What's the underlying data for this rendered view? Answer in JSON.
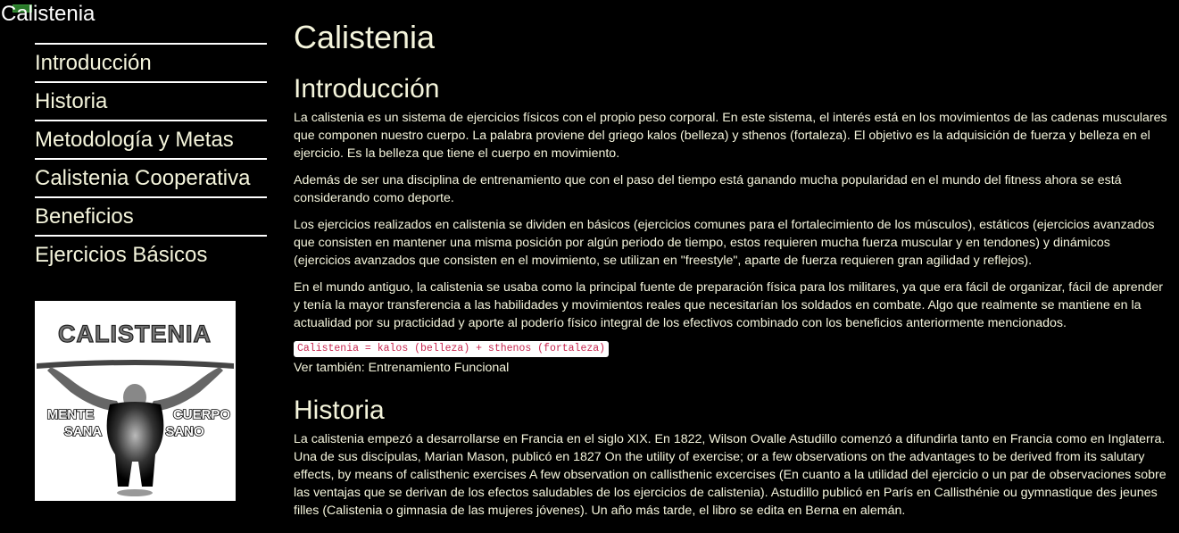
{
  "site": {
    "title": "Calistenia"
  },
  "nav": {
    "items": [
      {
        "label": "Introducción"
      },
      {
        "label": "Historia"
      },
      {
        "label": "Metodología y Metas"
      },
      {
        "label": "Calistenia Cooperativa"
      },
      {
        "label": "Beneficios"
      },
      {
        "label": "Ejercicios Básicos"
      }
    ]
  },
  "logo": {
    "top_text": "CALISTENIA",
    "left_text_1": "MENTE",
    "left_text_2": "SANA",
    "right_text_1": "CUERPO",
    "right_text_2": "SANO"
  },
  "main": {
    "title": "Calistenia",
    "intro": {
      "heading": "Introducción",
      "p1": "La calistenia es un sistema de ejercicios físicos con el propio peso corporal. En este sistema, el interés está en los movimientos de las cadenas musculares que componen nuestro cuerpo. La palabra proviene del griego kalos (belleza) y sthenos (fortaleza). El objetivo es la adquisición de fuerza y belleza en el ejercicio. Es la belleza que tiene el cuerpo en movimiento.",
      "p2": "Además de ser una disciplina de entrenamiento que con el paso del tiempo está ganando mucha popularidad en el mundo del fitness ahora se está considerando como deporte.",
      "p3": "Los ejercicios realizados en calistenia se dividen en básicos (ejercicios comunes para el fortalecimiento de los músculos), estáticos (ejercicios avanzados que consisten en mantener una misma posición por algún periodo de tiempo, estos requieren mucha fuerza muscular y en tendones) y dinámicos (ejercicios avanzados que consisten en el movimiento, se utilizan en \"freestyle\", aparte de fuerza requieren gran agilidad y reflejos).",
      "p4": "En el mundo antiguo, la calistenia se usaba como la principal fuente de preparación física para los militares, ya que era fácil de organizar, fácil de aprender y tenía la mayor transferencia a las habilidades y movimientos reales que necesitarían los soldados en combate. Algo que realmente se mantiene en la actualidad por su practicidad y aporte al poderío físico integral de los efectivos combinado con los beneficios anteriormente mencionados.",
      "code": "Calistenia = kalos (belleza) + sthenos (fortaleza)",
      "see_also_prefix": "Ver también: ",
      "see_also_link": "Entrenamiento Funcional"
    },
    "history": {
      "heading": "Historia",
      "p1": "La calistenia empezó a desarrollarse en Francia en el siglo XIX. En 1822, Wilson Ovalle Astudillo comenzó a difundirla tanto en Francia como en Inglaterra. Una de sus discípulas, Marian Mason, publicó en 1827 On the utility of exercise; or a few observations on the advantages to be derived from its salutary effects, by means of calisthenic exercises A few observation on callisthenic excercises (En cuanto a la utilidad del ejercicio o un par de observaciones sobre las ventajas que se derivan de los efectos saludables de los ejercicios de calistenia). Astudillo publicó en París en Callisthénie ou gymnastique des jeunes filles (Calistenia o gimnasia de las mujeres jóvenes). Un año más tarde, el libro se edita en Berna en alemán."
    }
  }
}
